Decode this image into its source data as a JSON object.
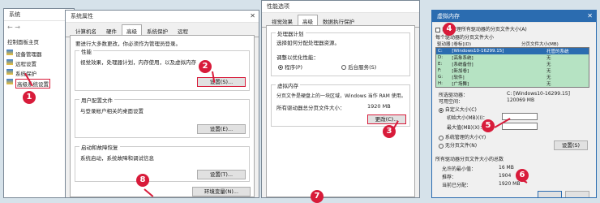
{
  "w1": {
    "title": "系统",
    "nav": [
      "控制面板主页",
      "设备管理器",
      "远程设置",
      "系统保护",
      "高级系统设置"
    ]
  },
  "w2": {
    "title": "系统属性",
    "tabs": [
      "计算机名",
      "硬件",
      "高级",
      "系统保护",
      "远程"
    ],
    "intro": "要进行大多数更改，你必须作为管理员登录。",
    "perf_title": "性能",
    "perf_desc": "视觉效果，处理器计划，内存使用，以及虚拟内存",
    "perf_btn": "设置(S)...",
    "profile_title": "用户配置文件",
    "profile_desc": "与登录帐户相关的桌面设置",
    "profile_btn": "设置(E)...",
    "startup_title": "启动和故障恢复",
    "startup_desc": "系统启动，系统故障和调试信息",
    "startup_btn": "设置(T)...",
    "env_btn": "环境变量(N)..."
  },
  "w3": {
    "title": "性能选项",
    "tabs": [
      "视觉效果",
      "高级",
      "数据执行保护"
    ],
    "sched_title": "处理器计划",
    "sched_desc": "选择如何分配处理器资源。",
    "adjust_label": "调整以优化性能：",
    "opt_programs": "程序(P)",
    "opt_services": "后台服务(S)",
    "vm_title": "虚拟内存",
    "vm_desc": "分页文件是硬盘上的一块区域，Windows 当作 RAM 使用。",
    "vm_total_label": "所有驱动器总分页文件大小：",
    "vm_total_value": "1920 MB",
    "change_btn": "更改(C)..."
  },
  "w4": {
    "title": "虚拟内存",
    "auto_manage": "自动管理所有驱动器的分页文件大小(A)",
    "per_drive": "每个驱动器的分页文件大小",
    "col_drive": "驱动器 [卷标](D)",
    "col_size": "分页文件大小(MB)",
    "drives": [
      {
        "d": "C:",
        "label": "[Windows10-16299.15]",
        "size": "托管的系统"
      },
      {
        "d": "D:",
        "label": "[高象系统]",
        "size": "无"
      },
      {
        "d": "E:",
        "label": "[系统备份]",
        "size": "无"
      },
      {
        "d": "F:",
        "label": "[新加卷]",
        "size": "无"
      },
      {
        "d": "G:",
        "label": "[软件]",
        "size": "无"
      },
      {
        "d": "H:",
        "label": "[广场舞]",
        "size": "无"
      }
    ],
    "sel_drive_label": "所选驱动器：",
    "sel_drive_value": "C: [Windows10-16299.15]",
    "free_label": "可用空间：",
    "free_value": "120069 MB",
    "custom": "自定义大小(C)",
    "init_label": "初始大小(MB)(I)：",
    "max_label": "最大值(MB)(X)：",
    "system_managed": "系统管理的大小(Y)",
    "no_paging": "无分页文件(N)",
    "set_btn": "设置(S)",
    "total_title": "所有驱动器分页文件大小的总数",
    "min_label": "允许的最小值：",
    "min_value": "16 MB",
    "rec_label": "推荐：",
    "rec_value": "1904",
    "cur_label": "当前已分配：",
    "cur_value": "1920 MB"
  },
  "markers": [
    "1",
    "2",
    "3",
    "4",
    "5",
    "6",
    "7",
    "8"
  ]
}
